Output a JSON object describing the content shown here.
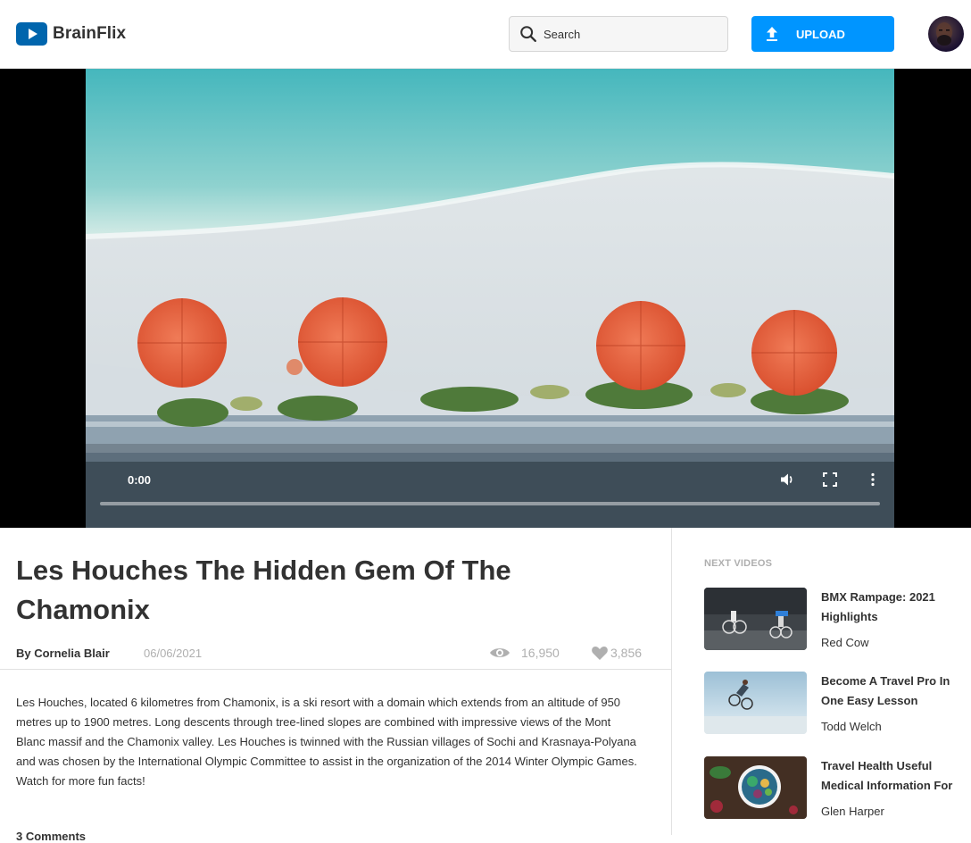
{
  "header": {
    "logo_text": "BrainFlix",
    "search_placeholder": "Search",
    "upload_label": "UPLOAD"
  },
  "player": {
    "current_time": "0:00",
    "progress": 0
  },
  "video": {
    "title": "Les Houches The Hidden Gem Of The Chamonix",
    "author": "By Cornelia Blair",
    "date": "06/06/2021",
    "views": "16,950",
    "likes": "3,856",
    "description": "Les Houches, located 6 kilometres from Chamonix, is a ski resort with a domain which extends from an altitude of 950 metres up to 1900 metres. Long descents through tree-lined slopes are combined with impressive views of the Mont Blanc massif and the Chamonix valley. Les Houches is twinned with the Russian villages of Sochi and Krasnaya-Polyana and was chosen by the International Olympic Committee to assist in the organization of the 2014 Winter Olympic Games. Watch for more fun facts!",
    "comments_heading": "3 Comments"
  },
  "next_videos": {
    "heading": "NEXT VIDEOS",
    "items": [
      {
        "title": "BMX Rampage: 2021 Highlights",
        "channel": "Red Cow"
      },
      {
        "title": "Become A Travel Pro In One Easy Lesson",
        "channel": "Todd Welch"
      },
      {
        "title": "Travel Health Useful Medical Information For",
        "channel": "Glen Harper"
      }
    ]
  },
  "colors": {
    "brand": "#0065ad",
    "button": "#0095ff",
    "text": "#323232",
    "muted": "#afafaf"
  },
  "icons": [
    "play-logo-icon",
    "search-icon",
    "upload-icon",
    "volume-icon",
    "fullscreen-icon",
    "more-vertical-icon",
    "views-eye-icon",
    "likes-heart-icon"
  ]
}
